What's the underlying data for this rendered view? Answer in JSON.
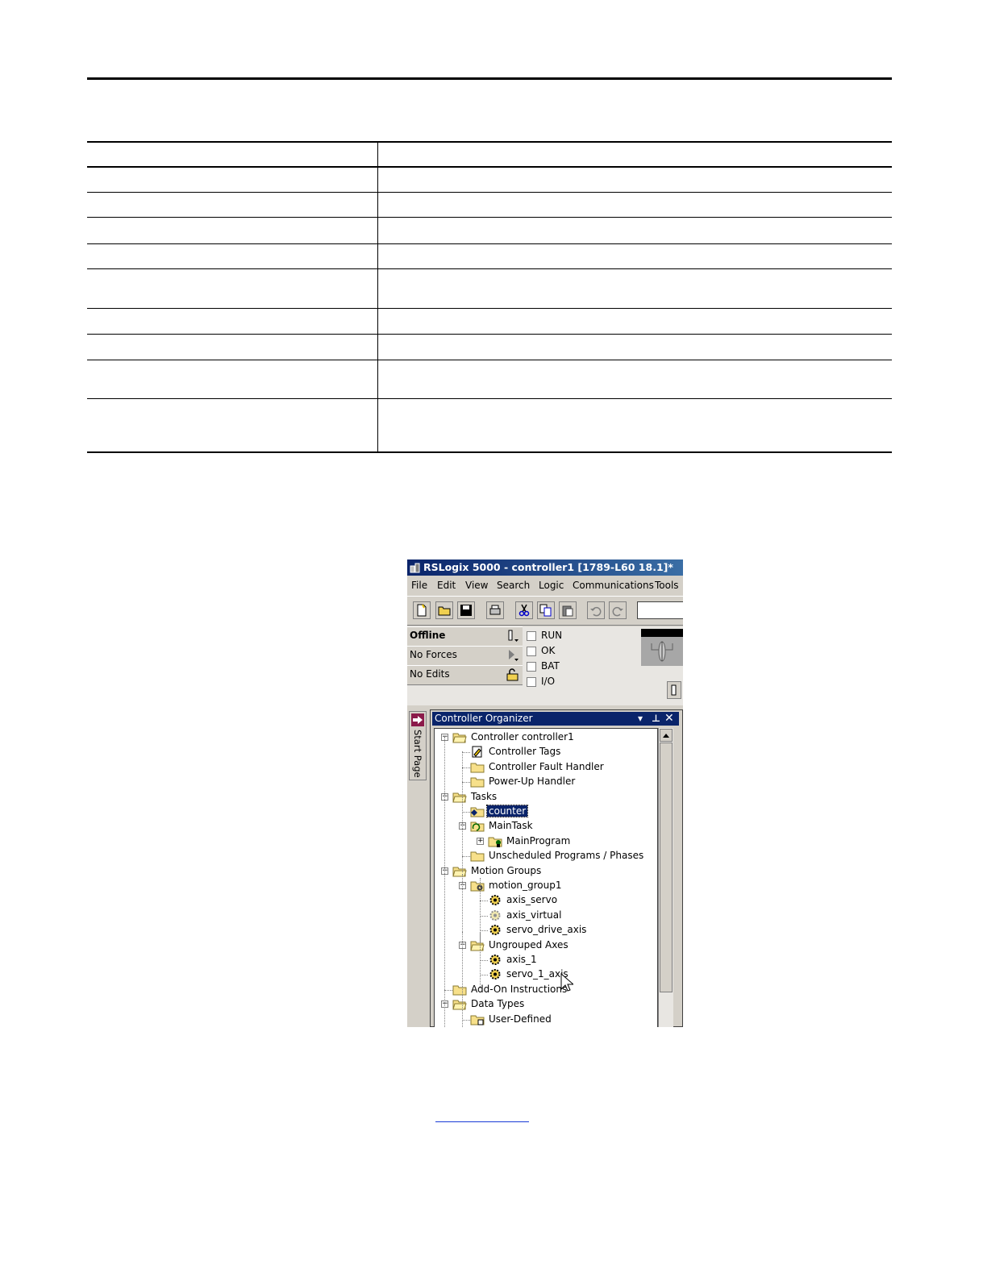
{
  "window": {
    "title": "RSLogix 5000 - controller1 [1789-L60 18.1]*",
    "menu": [
      "File",
      "Edit",
      "View",
      "Search",
      "Logic",
      "Communications",
      "Tools"
    ]
  },
  "status": {
    "mode": "Offline",
    "forces": "No Forces",
    "edits": "No Edits",
    "lights": [
      "RUN",
      "OK",
      "BAT",
      "I/O"
    ]
  },
  "start_page_tab": "Start Page",
  "organizer": {
    "title": "Controller Organizer",
    "tree": [
      {
        "label": "Controller controller1",
        "icon": "folder-open-icon"
      },
      {
        "label": "Controller Tags",
        "icon": "tags-icon"
      },
      {
        "label": "Controller Fault Handler",
        "icon": "folder-icon"
      },
      {
        "label": "Power-Up Handler",
        "icon": "folder-icon"
      },
      {
        "label": "Tasks",
        "icon": "folder-open-icon"
      },
      {
        "label": "counter",
        "icon": "event-task-icon",
        "selected": true
      },
      {
        "label": "MainTask",
        "icon": "continuous-task-icon"
      },
      {
        "label": "MainProgram",
        "icon": "program-icon"
      },
      {
        "label": "Unscheduled Programs / Phases",
        "icon": "folder-icon"
      },
      {
        "label": "Motion Groups",
        "icon": "folder-open-icon"
      },
      {
        "label": "motion_group1",
        "icon": "motion-group-icon"
      },
      {
        "label": "axis_servo",
        "icon": "axis-icon"
      },
      {
        "label": "axis_virtual",
        "icon": "axis-virtual-icon"
      },
      {
        "label": "servo_drive_axis",
        "icon": "axis-icon"
      },
      {
        "label": "Ungrouped Axes",
        "icon": "folder-open-icon"
      },
      {
        "label": "axis_1",
        "icon": "axis-icon"
      },
      {
        "label": "servo_1_axis",
        "icon": "axis-icon"
      },
      {
        "label": "Add-On Instructions",
        "icon": "folder-icon"
      },
      {
        "label": "Data Types",
        "icon": "folder-open-icon"
      },
      {
        "label": "User-Defined",
        "icon": "user-defined-icon"
      }
    ]
  }
}
